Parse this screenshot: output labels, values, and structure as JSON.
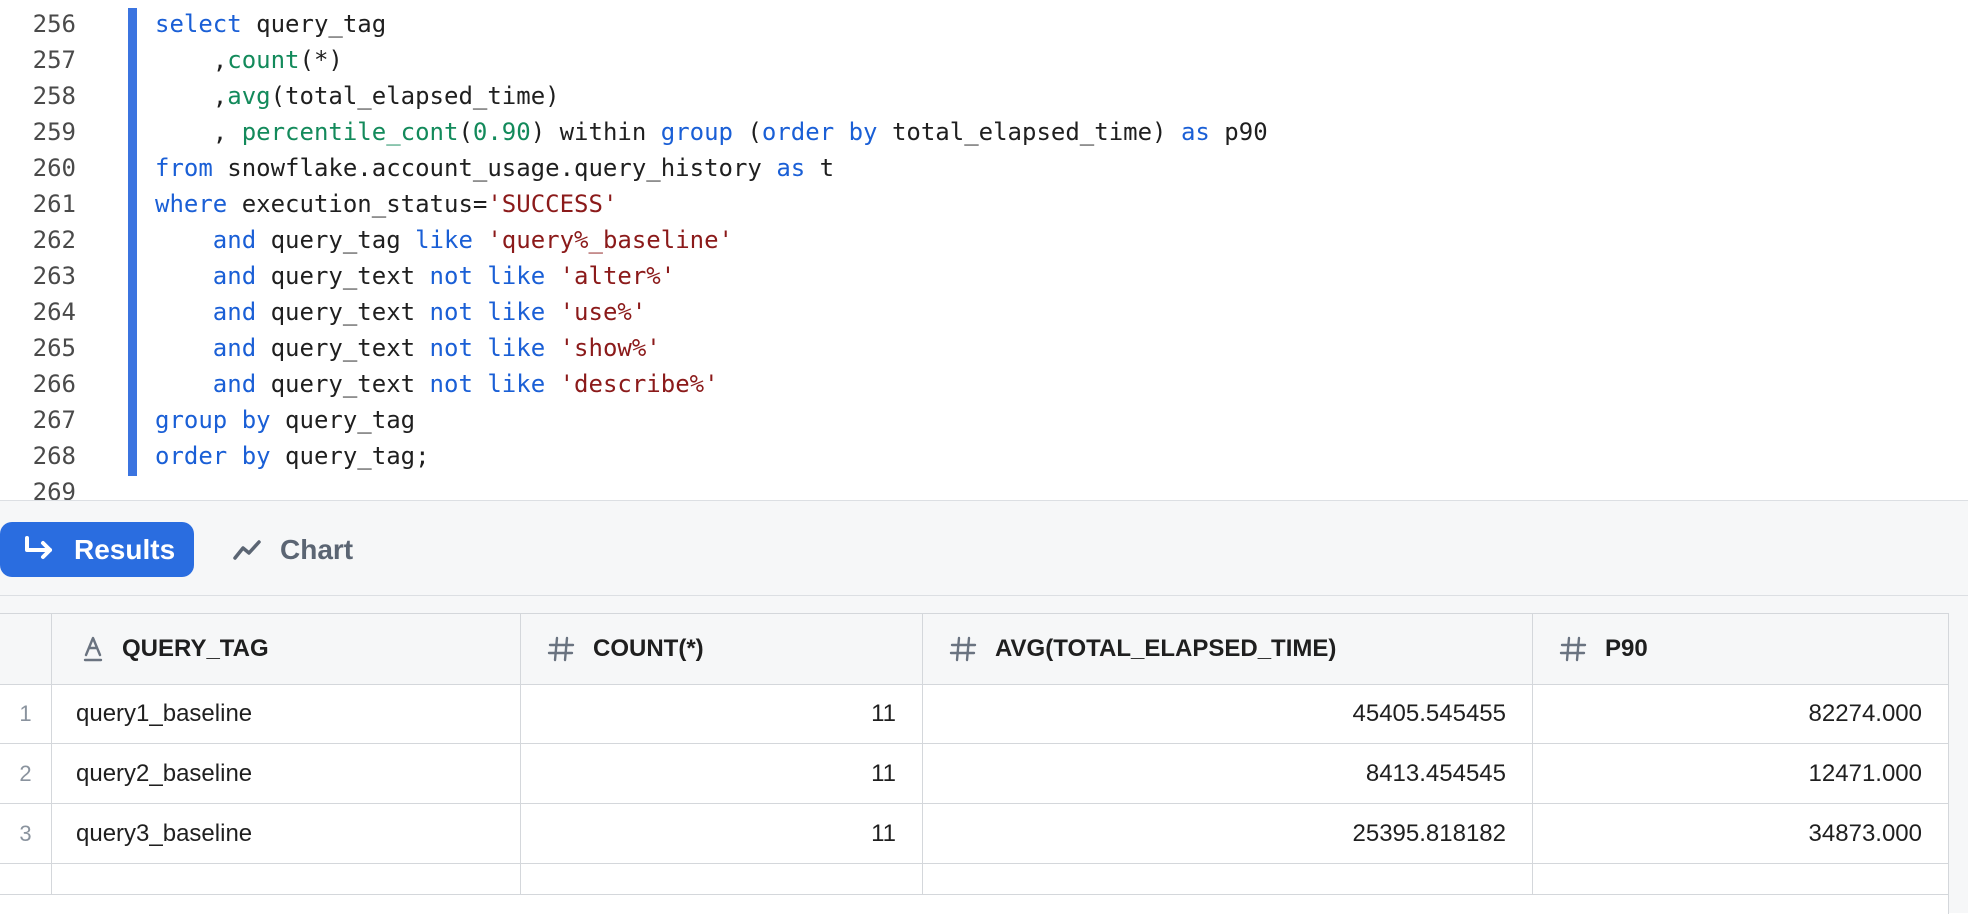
{
  "editor": {
    "lines": [
      {
        "num": "256",
        "tokens": [
          {
            "t": "select",
            "c": "kw"
          },
          {
            "t": " query_tag",
            "c": "id"
          }
        ]
      },
      {
        "num": "257",
        "tokens": [
          {
            "t": "    ,",
            "c": "id"
          },
          {
            "t": "count",
            "c": "fn"
          },
          {
            "t": "(*)",
            "c": "id"
          }
        ]
      },
      {
        "num": "258",
        "tokens": [
          {
            "t": "    ,",
            "c": "id"
          },
          {
            "t": "avg",
            "c": "fn"
          },
          {
            "t": "(total_elapsed_time)",
            "c": "id"
          }
        ]
      },
      {
        "num": "259",
        "tokens": [
          {
            "t": "    , ",
            "c": "id"
          },
          {
            "t": "percentile_cont",
            "c": "fn"
          },
          {
            "t": "(",
            "c": "id"
          },
          {
            "t": "0.90",
            "c": "num"
          },
          {
            "t": ") within ",
            "c": "id"
          },
          {
            "t": "group",
            "c": "kw"
          },
          {
            "t": " (",
            "c": "id"
          },
          {
            "t": "order by",
            "c": "kw"
          },
          {
            "t": " total_elapsed_time) ",
            "c": "id"
          },
          {
            "t": "as",
            "c": "kw"
          },
          {
            "t": " p90",
            "c": "id"
          }
        ]
      },
      {
        "num": "260",
        "tokens": [
          {
            "t": "from",
            "c": "kw"
          },
          {
            "t": " snowflake.account_usage.query_history ",
            "c": "id"
          },
          {
            "t": "as",
            "c": "kw"
          },
          {
            "t": " t",
            "c": "id"
          }
        ]
      },
      {
        "num": "261",
        "tokens": [
          {
            "t": "where",
            "c": "kw"
          },
          {
            "t": " execution_status=",
            "c": "id"
          },
          {
            "t": "'SUCCESS'",
            "c": "str"
          }
        ]
      },
      {
        "num": "262",
        "tokens": [
          {
            "t": "    ",
            "c": "id"
          },
          {
            "t": "and",
            "c": "kw"
          },
          {
            "t": " query_tag ",
            "c": "id"
          },
          {
            "t": "like",
            "c": "kw"
          },
          {
            "t": " ",
            "c": "id"
          },
          {
            "t": "'query%_baseline'",
            "c": "str"
          }
        ]
      },
      {
        "num": "263",
        "tokens": [
          {
            "t": "    ",
            "c": "id"
          },
          {
            "t": "and",
            "c": "kw"
          },
          {
            "t": " query_text ",
            "c": "id"
          },
          {
            "t": "not like",
            "c": "kw"
          },
          {
            "t": " ",
            "c": "id"
          },
          {
            "t": "'alter%'",
            "c": "str"
          }
        ]
      },
      {
        "num": "264",
        "tokens": [
          {
            "t": "    ",
            "c": "id"
          },
          {
            "t": "and",
            "c": "kw"
          },
          {
            "t": " query_text ",
            "c": "id"
          },
          {
            "t": "not like",
            "c": "kw"
          },
          {
            "t": " ",
            "c": "id"
          },
          {
            "t": "'use%'",
            "c": "str"
          }
        ]
      },
      {
        "num": "265",
        "tokens": [
          {
            "t": "    ",
            "c": "id"
          },
          {
            "t": "and",
            "c": "kw"
          },
          {
            "t": " query_text ",
            "c": "id"
          },
          {
            "t": "not like",
            "c": "kw"
          },
          {
            "t": " ",
            "c": "id"
          },
          {
            "t": "'show%'",
            "c": "str"
          }
        ]
      },
      {
        "num": "266",
        "tokens": [
          {
            "t": "    ",
            "c": "id"
          },
          {
            "t": "and",
            "c": "kw"
          },
          {
            "t": " query_text ",
            "c": "id"
          },
          {
            "t": "not like",
            "c": "kw"
          },
          {
            "t": " ",
            "c": "id"
          },
          {
            "t": "'describe%'",
            "c": "str"
          }
        ]
      },
      {
        "num": "267",
        "tokens": [
          {
            "t": "group by",
            "c": "kw"
          },
          {
            "t": " query_tag",
            "c": "id"
          }
        ]
      },
      {
        "num": "268",
        "tokens": [
          {
            "t": "order by",
            "c": "kw"
          },
          {
            "t": " query_tag;",
            "c": "id"
          }
        ]
      },
      {
        "num": "269",
        "tokens": []
      }
    ]
  },
  "tabs": {
    "results_label": "Results",
    "chart_label": "Chart"
  },
  "table": {
    "columns": [
      {
        "label": "QUERY_TAG",
        "type_icon": "text-type-icon"
      },
      {
        "label": "COUNT(*)",
        "type_icon": "number-type-icon"
      },
      {
        "label": "AVG(TOTAL_ELAPSED_TIME)",
        "type_icon": "number-type-icon"
      },
      {
        "label": "P90",
        "type_icon": "number-type-icon"
      }
    ],
    "rows": [
      {
        "idx": "1",
        "cells": [
          "query1_baseline",
          "11",
          "45405.545455",
          "82274.000"
        ]
      },
      {
        "idx": "2",
        "cells": [
          "query2_baseline",
          "11",
          "8413.454545",
          "12471.000"
        ]
      },
      {
        "idx": "3",
        "cells": [
          "query3_baseline",
          "11",
          "25395.818182",
          "34873.000"
        ]
      }
    ]
  },
  "colors": {
    "accent": "#2a6de0",
    "keyword": "#1a5fd6",
    "function": "#138a5b",
    "string": "#8b1a1a"
  }
}
